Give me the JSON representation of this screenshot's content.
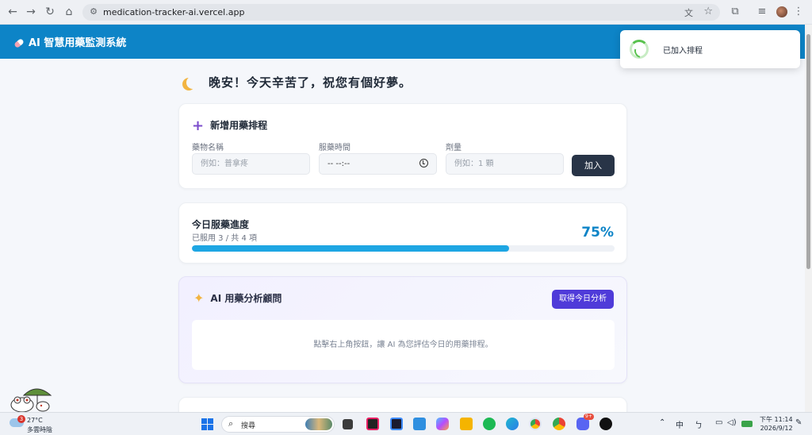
{
  "browser": {
    "url": "medication-tracker-ai.vercel.app"
  },
  "app": {
    "title": "AI 智慧用藥監測系統"
  },
  "greeting": "晚安！今天辛苦了，祝您有個好夢。",
  "add_form": {
    "title": "新增用藥排程",
    "med_name_label": "藥物名稱",
    "med_name_placeholder": "例如：普拿疼",
    "time_label": "服藥時間",
    "time_value": "-- --:--",
    "dose_label": "劑量",
    "dose_placeholder": "例如：1 顆",
    "add_button": "加入"
  },
  "progress": {
    "title": "今日服藥進度",
    "subtitle": "已服用 3 / 共 4 項",
    "percent_label": "75%",
    "fraction": 0.75
  },
  "ai_advisor": {
    "title": "AI 用藥分析顧問",
    "button": "取得今日分析",
    "placeholder": "點擊右上角按鈕，讓 AI 為您評估今日的用藥排程。"
  },
  "toast": {
    "message": "已加入排程"
  },
  "taskbar": {
    "weather_badge": "3",
    "temperature": "27°C",
    "condition": "多雲時陰",
    "search_label": "搜尋",
    "ime": "中",
    "time": "下午 11:14",
    "date": "2026/9/12",
    "discord_badge": "9+"
  },
  "colors": {
    "header": "#0d84c7",
    "progress_fill": "#1ea6e3",
    "ai_button": "#4f3bd9",
    "add_button": "#283447"
  }
}
